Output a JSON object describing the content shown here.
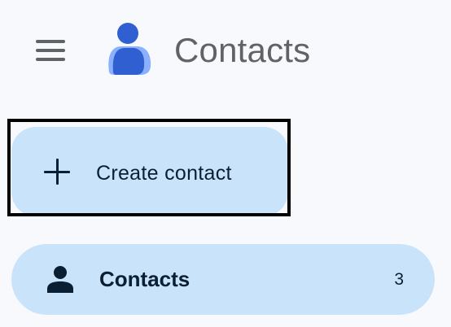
{
  "header": {
    "menu_icon": "hamburger-menu-icon",
    "logo_icon": "contacts-logo-icon",
    "title": "Contacts"
  },
  "create_contact": {
    "icon": "plus-icon",
    "label": "Create contact"
  },
  "nav": {
    "items": [
      {
        "icon": "person-icon",
        "label": "Contacts",
        "count": "3",
        "selected": true
      }
    ]
  },
  "colors": {
    "background": "#f8f9fc",
    "selected_bg": "#c9e3fb",
    "logo_blue": "#2f5fd0",
    "logo_light": "#8ab0ff",
    "text_dark": "#0b1f33",
    "text_grey": "#5f6368"
  }
}
